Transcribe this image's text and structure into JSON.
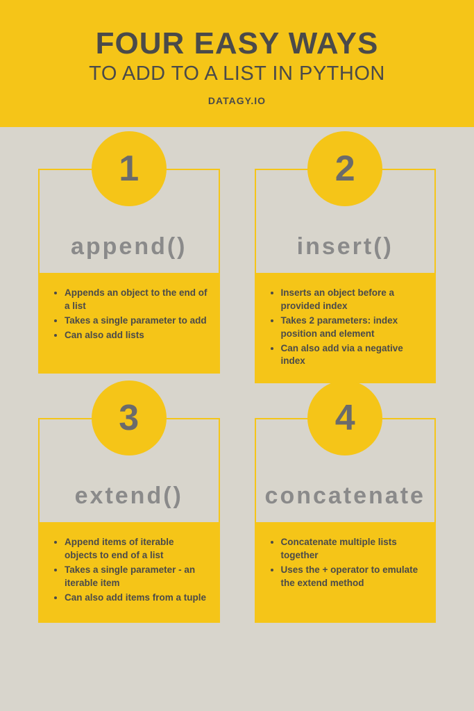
{
  "header": {
    "title": "FOUR EASY WAYS",
    "subtitle": "TO ADD TO A LIST IN PYTHON",
    "site": "DATAGY.IO"
  },
  "cards": [
    {
      "num": "1",
      "name": "append()",
      "points": [
        "Appends an object to the end of a list",
        "Takes a single parameter to add",
        "Can also add lists"
      ]
    },
    {
      "num": "2",
      "name": "insert()",
      "points": [
        "Inserts an object before a provided index",
        "Takes 2 parameters: index position and element",
        "Can also add via a negative index"
      ]
    },
    {
      "num": "3",
      "name": "extend()",
      "points": [
        "Append items of iterable objects to end of a list",
        "Takes a single parameter - an iterable item",
        "Can also add items from a tuple"
      ]
    },
    {
      "num": "4",
      "name": "concatenate",
      "points": [
        "Concatenate multiple lists together",
        "Uses the + operator to emulate the extend method"
      ]
    }
  ]
}
